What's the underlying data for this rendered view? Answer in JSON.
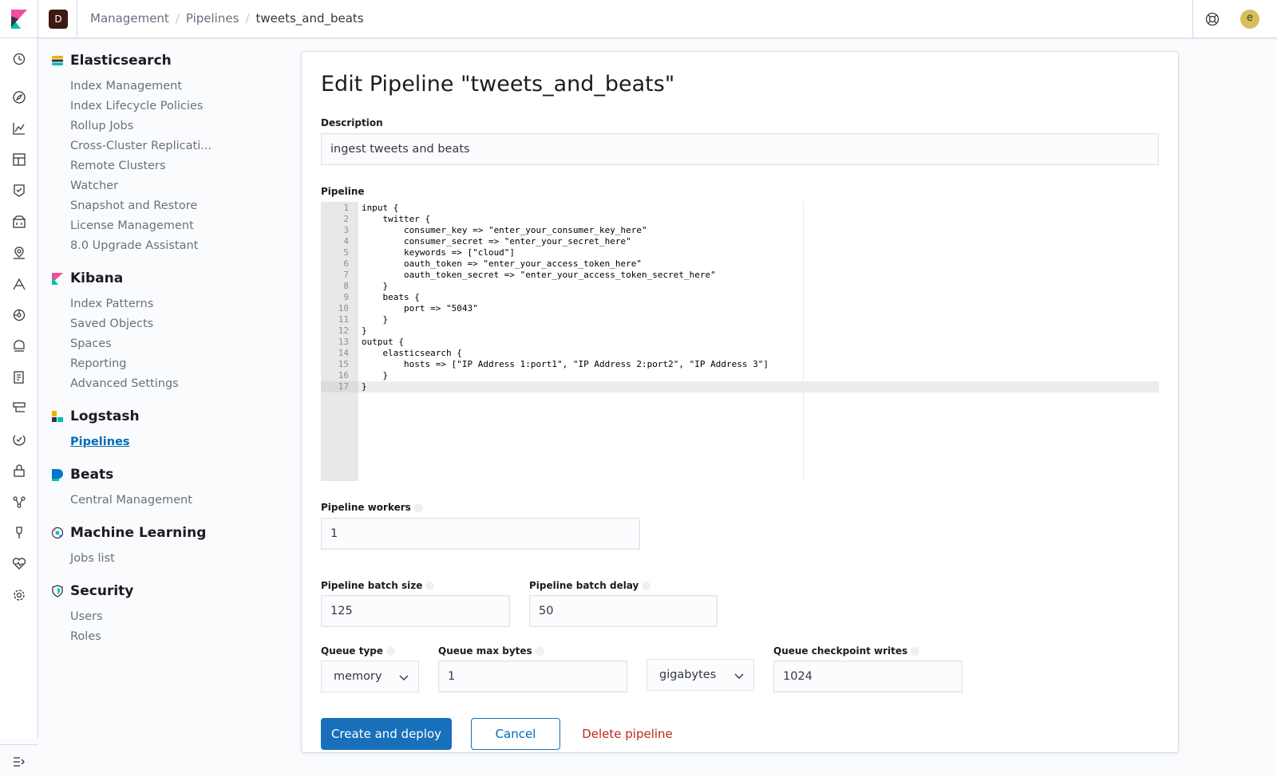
{
  "header": {
    "space_initial": "D",
    "breadcrumbs": [
      "Management",
      "Pipelines",
      "tweets_and_beats"
    ],
    "user_initial": "e"
  },
  "sidebar": {
    "sections": [
      {
        "title": "Elasticsearch",
        "items": [
          "Index Management",
          "Index Lifecycle Policies",
          "Rollup Jobs",
          "Cross-Cluster Replicati...",
          "Remote Clusters",
          "Watcher",
          "Snapshot and Restore",
          "License Management",
          "8.0 Upgrade Assistant"
        ]
      },
      {
        "title": "Kibana",
        "items": [
          "Index Patterns",
          "Saved Objects",
          "Spaces",
          "Reporting",
          "Advanced Settings"
        ]
      },
      {
        "title": "Logstash",
        "items": [
          "Pipelines"
        ]
      },
      {
        "title": "Beats",
        "items": [
          "Central Management"
        ]
      },
      {
        "title": "Machine Learning",
        "items": [
          "Jobs list"
        ]
      },
      {
        "title": "Security",
        "items": [
          "Users",
          "Roles"
        ]
      }
    ],
    "active_item": "Pipelines"
  },
  "form": {
    "title": "Edit Pipeline \"tweets_and_beats\"",
    "description_label": "Description",
    "description_value": "ingest tweets and beats",
    "pipeline_label": "Pipeline",
    "code_lines": [
      "input {",
      "    twitter {",
      "        consumer_key => \"enter_your_consumer_key_here\"",
      "        consumer_secret => \"enter_your_secret_here\"",
      "        keywords => [\"cloud\"]",
      "        oauth_token => \"enter_your_access_token_here\"",
      "        oauth_token_secret => \"enter_your_access_token_secret_here\"",
      "    }",
      "    beats {",
      "        port => \"5043\"",
      "    }",
      "}",
      "output {",
      "    elasticsearch {",
      "        hosts => [\"IP Address 1:port1\", \"IP Address 2:port2\", \"IP Address 3\"]",
      "    }",
      "}"
    ],
    "active_line": 17,
    "workers_label": "Pipeline workers",
    "workers_value": "1",
    "batch_size_label": "Pipeline batch size",
    "batch_size_value": "125",
    "batch_delay_label": "Pipeline batch delay",
    "batch_delay_value": "50",
    "queue_type_label": "Queue type",
    "queue_type_value": "memory",
    "queue_max_bytes_label": "Queue max bytes",
    "queue_max_bytes_value": "1",
    "queue_units_value": "gigabytes",
    "checkpoint_label": "Queue checkpoint writes",
    "checkpoint_value": "1024"
  },
  "actions": {
    "create_label": "Create and deploy",
    "cancel_label": "Cancel",
    "delete_label": "Delete pipeline"
  },
  "colors": {
    "primary": "#1870bb",
    "danger": "#bd271e",
    "link": "#006bb8"
  }
}
